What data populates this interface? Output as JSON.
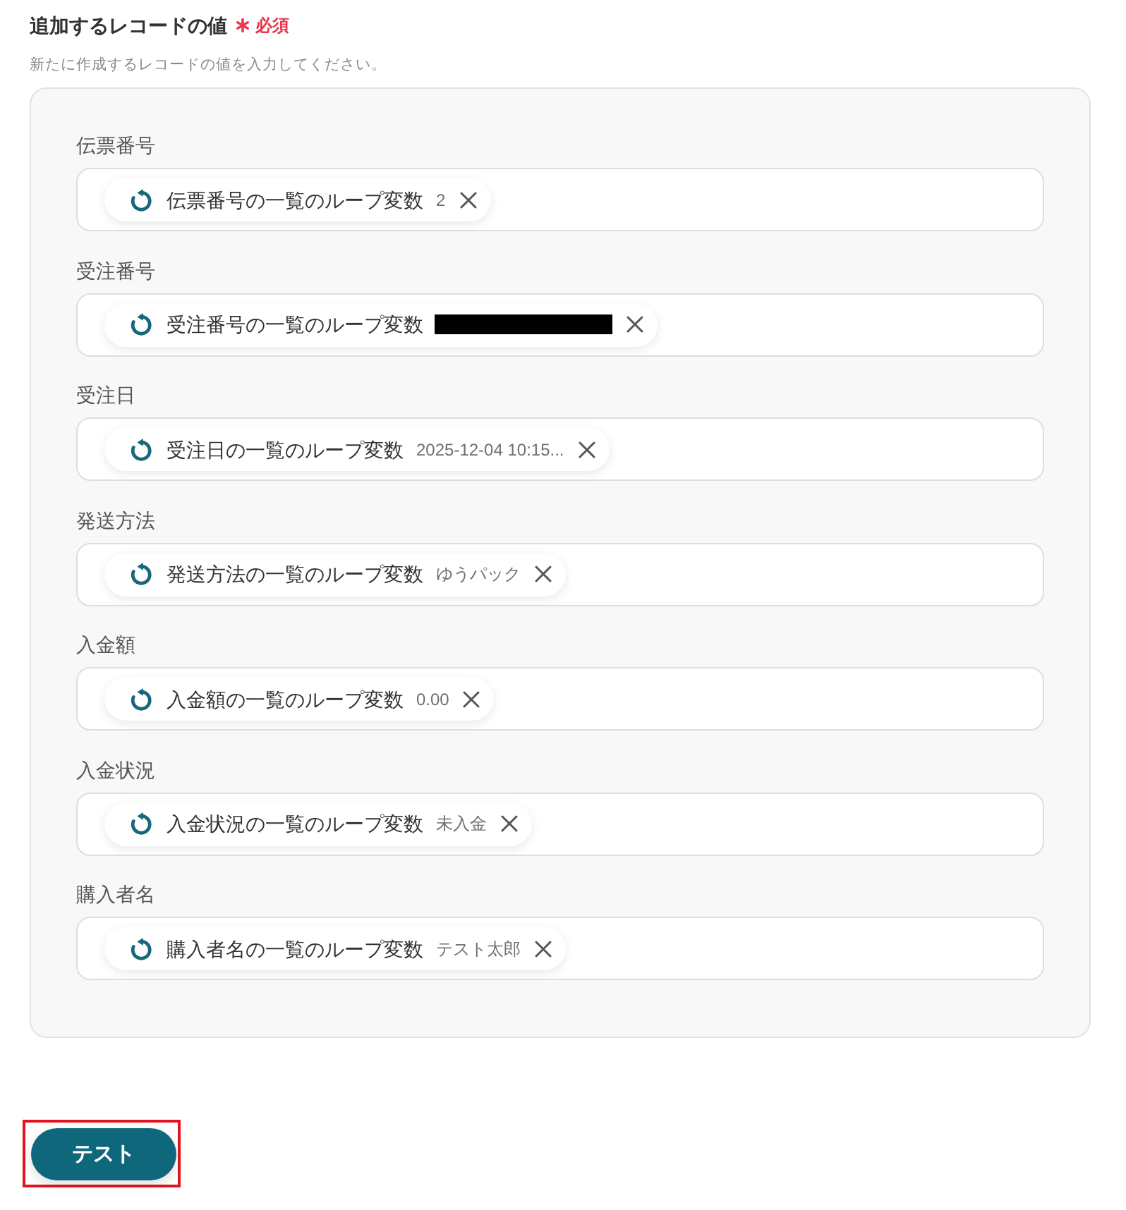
{
  "header": {
    "title": "追加するレコードの値",
    "required": true,
    "required_label": "必須",
    "description": "新たに作成するレコードの値を入力してください。"
  },
  "fields": [
    {
      "label": "伝票番号",
      "chip": {
        "name": "伝票番号の一覧のループ変数",
        "value": "2",
        "redacted": false
      }
    },
    {
      "label": "受注番号",
      "chip": {
        "name": "受注番号の一覧のループ変数",
        "redacted": true
      }
    },
    {
      "label": "受注日",
      "chip": {
        "name": "受注日の一覧のループ変数",
        "value": "2025-12-04 10:15...",
        "redacted": false
      }
    },
    {
      "label": "発送方法",
      "chip": {
        "name": "発送方法の一覧のループ変数",
        "value": "ゆうパック",
        "redacted": false
      }
    },
    {
      "label": "入金額",
      "chip": {
        "name": "入金額の一覧のループ変数",
        "value": "0.00",
        "redacted": false
      }
    },
    {
      "label": "入金状況",
      "chip": {
        "name": "入金状況の一覧のループ変数",
        "value": "未入金",
        "redacted": false
      }
    },
    {
      "label": "購入者名",
      "chip": {
        "name": "購入者名の一覧のループ変数",
        "value": "テスト太郎",
        "redacted": false
      }
    }
  ],
  "test_button": {
    "label": "テスト",
    "highlighted": true
  }
}
